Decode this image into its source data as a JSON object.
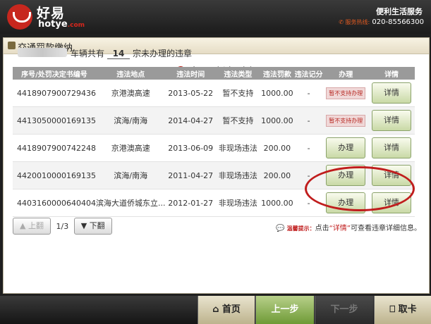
{
  "header": {
    "logo_cn": "好易",
    "logo_en": "hotye",
    "logo_en_suffix": ".com",
    "service_name": "便利生活服务",
    "hotline_label": "服务热线:",
    "hotline_number": "020-85566300"
  },
  "panel": {
    "title": "交通罚款缴纳",
    "list_title": "交通违法列表",
    "summary_prefix": "车辆共有",
    "vehicle_count": "14",
    "summary_suffix": "宗未办理的违章"
  },
  "table": {
    "headers": [
      "序号/处罚决定书编号",
      "违法地点",
      "违法时间",
      "违法类型",
      "违法罚款",
      "违法记分",
      "办理",
      "详情"
    ],
    "rows": [
      {
        "no": "4418907900729436",
        "place": "京港澳高速",
        "time": "2013-05-22",
        "type": "暂不支持",
        "fine": "1000.00",
        "points": "-",
        "action": "暂不支持办理",
        "detail": "详情"
      },
      {
        "no": "4413050000169135",
        "place": "滨海/南海",
        "time": "2014-04-27",
        "type": "暂不支持",
        "fine": "1000.00",
        "points": "-",
        "action": "暂不支持办理",
        "detail": "详情"
      },
      {
        "no": "4418907900742248",
        "place": "京港澳高速",
        "time": "2013-06-09",
        "type": "非现场违法",
        "fine": "200.00",
        "points": "-",
        "action": "办理",
        "detail": "详情"
      },
      {
        "no": "4420010000169135",
        "place": "滨海/南海",
        "time": "2011-04-27",
        "type": "非现场违法",
        "fine": "200.00",
        "points": "-",
        "action": "办理",
        "detail": "详情"
      },
      {
        "no": "4403160000640404",
        "place": "滨海大道侨城东立...",
        "time": "2012-01-27",
        "type": "非现场违法",
        "fine": "1000.00",
        "points": "-",
        "action": "办理",
        "detail": "详情"
      }
    ]
  },
  "pager": {
    "prev_label": "上翻",
    "page": "1/3",
    "next_label": "下翻"
  },
  "hint": {
    "label": "温馨提示：",
    "text_before": "点击",
    "quoted": "“详情”",
    "text_after": "可查看违章详细信息。"
  },
  "footer": {
    "home": "首页",
    "prev": "上一步",
    "next": "下一步",
    "card": "取卡"
  },
  "colors": {
    "brand_red": "#c7271e",
    "button_green": "#c9d9a6"
  }
}
